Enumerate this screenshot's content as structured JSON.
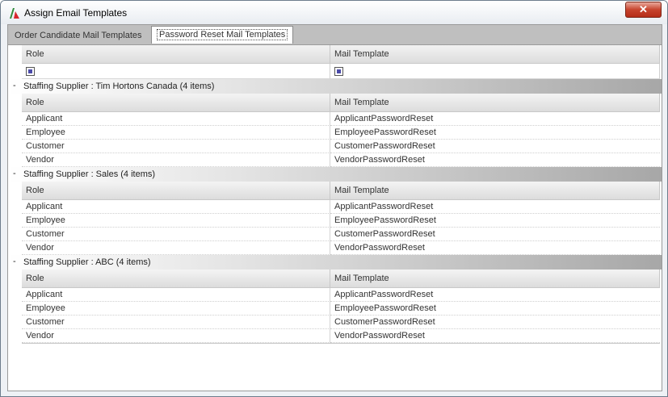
{
  "window": {
    "title": "Assign Email Templates",
    "close_symbol": "✕"
  },
  "tabs": [
    {
      "label": "Order Candidate Mail Templates"
    },
    {
      "label": "Password Reset Mail Templates"
    }
  ],
  "columns": {
    "role": "Role",
    "mail": "Mail Template"
  },
  "groups": [
    {
      "label": "Staffing Supplier : Tim Hortons Canada (4 items)",
      "rows": [
        {
          "role": "Applicant",
          "mail": "ApplicantPasswordReset"
        },
        {
          "role": "Employee",
          "mail": "EmployeePasswordReset"
        },
        {
          "role": "Customer",
          "mail": "CustomerPasswordReset"
        },
        {
          "role": "Vendor",
          "mail": "VendorPasswordReset"
        }
      ]
    },
    {
      "label": "Staffing Supplier : Sales (4 items)",
      "rows": [
        {
          "role": "Applicant",
          "mail": "ApplicantPasswordReset"
        },
        {
          "role": "Employee",
          "mail": "EmployeePasswordReset"
        },
        {
          "role": "Customer",
          "mail": "CustomerPasswordReset"
        },
        {
          "role": "Vendor",
          "mail": "VendorPasswordReset"
        }
      ]
    },
    {
      "label": "Staffing Supplier : ABC (4 items)",
      "rows": [
        {
          "role": "Applicant",
          "mail": "ApplicantPasswordReset"
        },
        {
          "role": "Employee",
          "mail": "EmployeePasswordReset"
        },
        {
          "role": "Customer",
          "mail": "CustomerPasswordReset"
        },
        {
          "role": "Vendor",
          "mail": "VendorPasswordReset"
        }
      ]
    }
  ],
  "collapse_symbol": "-"
}
